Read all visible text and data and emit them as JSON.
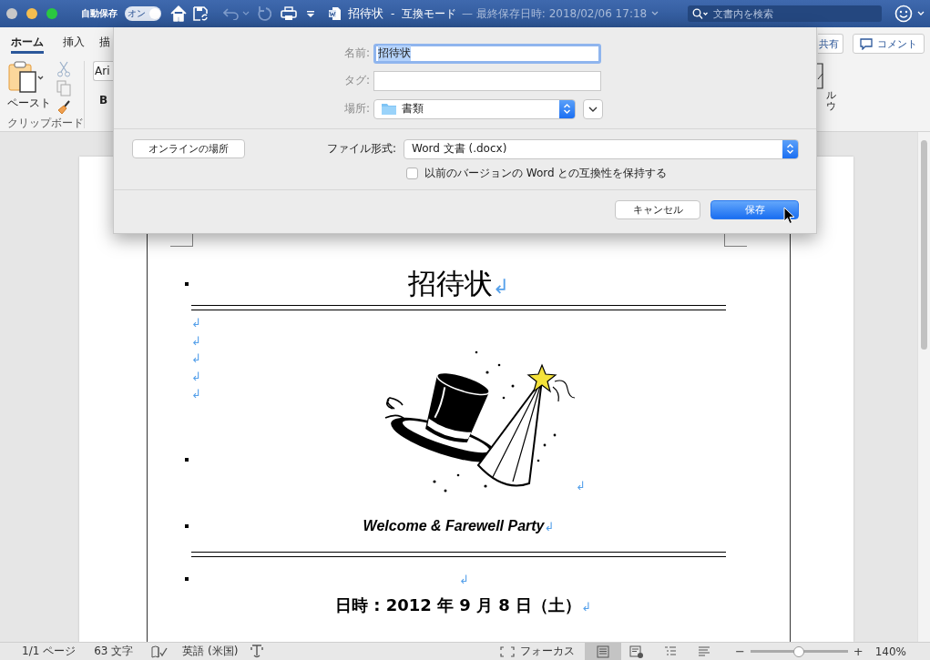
{
  "title_bar": {
    "autosave_label": "自動保存",
    "autosave_toggle": {
      "label": "オン",
      "on": true
    },
    "document_title": "招待状",
    "mode": "-  互換モード",
    "last_saved": "— 最終保存日時: 2018/02/06 17:18",
    "search": {
      "placeholder": "文書内を検索"
    }
  },
  "ribbon": {
    "tabs": [
      {
        "label": "ホーム",
        "selected": true
      },
      {
        "label": "挿入",
        "selected": false
      },
      {
        "label": "描",
        "selected": false
      }
    ],
    "paste_label": "ペースト",
    "group_label": "クリップボード",
    "font_box": "Ari",
    "bold_button": "B",
    "share_button": "共有",
    "comment_button": "コメント",
    "partial_command_lines": [
      "ル",
      "ウ"
    ]
  },
  "save_dialog": {
    "name": {
      "label": "名前:",
      "value": "招待状",
      "text_selected": true
    },
    "tags": {
      "label": "タグ:"
    },
    "location": {
      "label": "場所:",
      "value": "書類"
    },
    "online_button": "オンラインの場所",
    "file_format": {
      "label": "ファイル形式:",
      "value": "Word 文書 (.docx)"
    },
    "compatibility": {
      "label": "以前のバージョンの Word との互換性を保持する",
      "checked": false
    },
    "buttons": [
      {
        "label": "キャンセル",
        "default": false
      },
      {
        "label": "保存",
        "default": true
      }
    ]
  },
  "document": {
    "paragraphs": [
      {
        "kind": "title",
        "text": "招待状",
        "mark": "↲",
        "bullet": true
      },
      {
        "kind": "rule"
      },
      {
        "kind": "empty",
        "mark": "↲",
        "bullet": false
      },
      {
        "kind": "empty",
        "mark": "↲",
        "bullet": false
      },
      {
        "kind": "empty",
        "mark": "↲",
        "bullet": false
      },
      {
        "kind": "empty",
        "mark": "↲",
        "bullet": false
      },
      {
        "kind": "empty",
        "mark": "↲",
        "bullet": false
      },
      {
        "kind": "picture",
        "mark": "↲",
        "bullet": true
      },
      {
        "kind": "subtitle",
        "text": "Welcome & Farewell Party",
        "mark": "↲",
        "bullet": true
      },
      {
        "kind": "rule"
      },
      {
        "kind": "empty_center",
        "mark": "↲",
        "bullet": true
      },
      {
        "kind": "date",
        "text": "日時 : 2012 年 9 月 8 日（土）",
        "mark": "↲",
        "bullet": false
      }
    ]
  },
  "status_bar": {
    "page": "1/1 ページ",
    "words": "63 文字",
    "language": "英語 (米国)",
    "focus": "フォーカス",
    "views": [
      {
        "kind": "print_layout",
        "selected": true
      },
      {
        "kind": "web_layout",
        "selected": false
      },
      {
        "kind": "outline",
        "selected": false
      },
      {
        "kind": "draft",
        "selected": false
      }
    ],
    "zoom_out": "−",
    "zoom_in": "+",
    "zoom": {
      "level": 0.5
    },
    "zoom_percent": "140%"
  }
}
